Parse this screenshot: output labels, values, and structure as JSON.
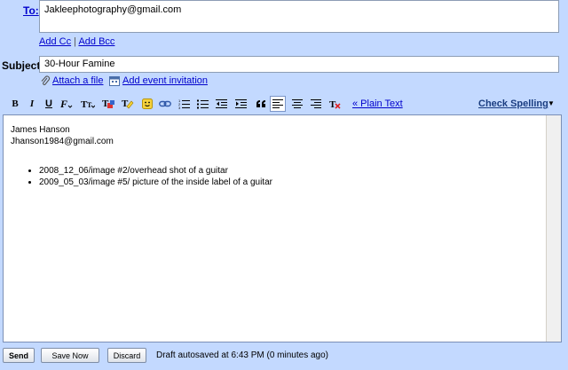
{
  "to": {
    "label": "To:",
    "value": "Jakleephotography@gmail.com",
    "add_cc": "Add Cc",
    "separator": "|",
    "add_bcc": "Add Bcc"
  },
  "subject": {
    "label": "Subject:",
    "value": "30-Hour Famine",
    "attach_file": "Attach a file",
    "add_event": "Add event invitation"
  },
  "toolbar": {
    "bold": "B",
    "italic": "I",
    "underline": "U",
    "plain_text": "« Plain Text",
    "check_spelling": "Check Spelling",
    "check_spelling_arrow": "▼",
    "active_item": "align-left"
  },
  "body": {
    "line1": "James Hanson",
    "line2": "Jhanson1984@gmail.com",
    "bullets": [
      "2008_12_06/image #2/overhead shot of a guitar",
      "2009_05_03/image #5/ picture of the inside label of a guitar"
    ]
  },
  "footer": {
    "send": "Send",
    "save_now": "Save Now",
    "discard": "Discard",
    "status": "Draft autosaved at 6:43 PM (0 minutes ago)"
  },
  "colors": {
    "panel": "#c3d9ff",
    "link": "#0000cc",
    "border": "#8d9db5"
  }
}
